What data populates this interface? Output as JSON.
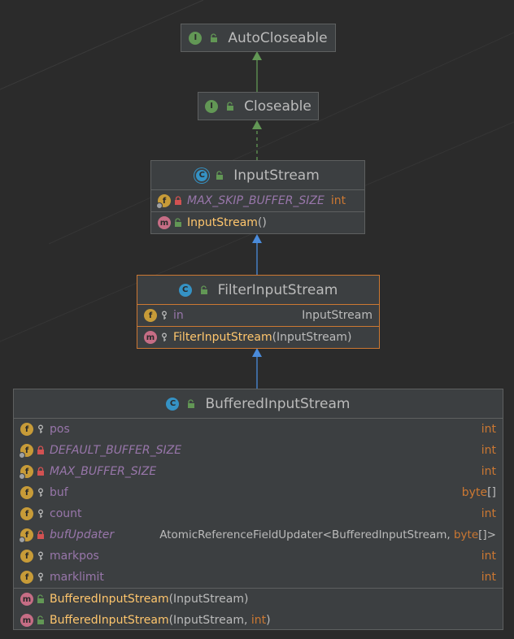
{
  "colors": {
    "background": "#2b2b2b",
    "node": "#3c3f41",
    "node_border": "#5e6060",
    "selected_border": "#cc7832",
    "interface_badge": "#629755",
    "class_badge": "#3592c4",
    "field_badge": "#c79b38",
    "method_badge": "#c66d85",
    "field_text": "#9876aa",
    "keyword": "#cc7832",
    "method_text": "#ffc66d",
    "interface_arrow": "#629755",
    "class_arrow": "#4a8bdb"
  },
  "nodes": {
    "autocloseable": {
      "title": "AutoCloseable",
      "kind": "interface",
      "badge": "I"
    },
    "closeable": {
      "title": "Closeable",
      "kind": "interface",
      "badge": "I"
    },
    "inputstream": {
      "title": "InputStream",
      "kind": "abstract-class",
      "badge": "C",
      "fields": [
        {
          "name": "MAX_SKIP_BUFFER_SIZE",
          "type": "int"
        }
      ],
      "methods": [
        {
          "name": "InputStream",
          "params": "()"
        }
      ]
    },
    "filterinputstream": {
      "title": "FilterInputStream",
      "kind": "class",
      "badge": "C",
      "fields": [
        {
          "name": "in",
          "type": "InputStream"
        }
      ],
      "methods": [
        {
          "name": "FilterInputStream",
          "params": "(InputStream)"
        }
      ]
    },
    "bufferedinputstream": {
      "title": "BufferedInputStream",
      "kind": "class",
      "badge": "C",
      "fields": [
        {
          "name": "pos",
          "type": "int"
        },
        {
          "name": "DEFAULT_BUFFER_SIZE",
          "type": "int"
        },
        {
          "name": "MAX_BUFFER_SIZE",
          "type": "int"
        },
        {
          "name": "buf",
          "type": "byte",
          "type_suffix": "[]"
        },
        {
          "name": "count",
          "type": "int"
        },
        {
          "name": "bufUpdater",
          "type_prefix": "AtomicReferenceFieldUpdater<BufferedInputStream, ",
          "type_kw": "byte",
          "type_suffix": "[]>"
        },
        {
          "name": "markpos",
          "type": "int"
        },
        {
          "name": "marklimit",
          "type": "int"
        }
      ],
      "methods": [
        {
          "name": "BufferedInputStream",
          "params": "(InputStream)"
        },
        {
          "name": "BufferedInputStream",
          "params_open": "(InputStream, ",
          "params_kw": "int",
          "params_close": ")"
        }
      ]
    }
  },
  "badge_letters": {
    "field": "f",
    "method": "m"
  }
}
